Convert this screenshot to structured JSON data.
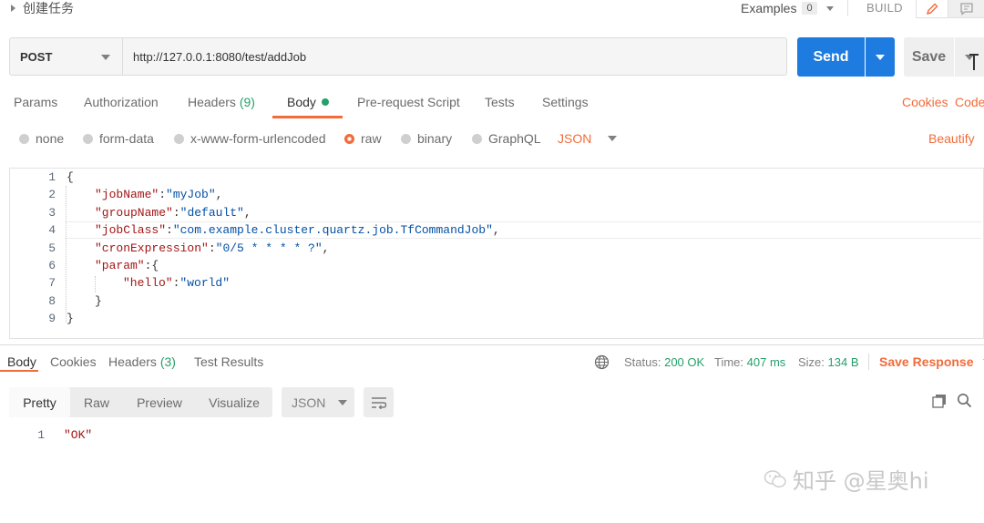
{
  "header": {
    "request_name": "创建任务",
    "examples_label": "Examples",
    "examples_count": "0",
    "build_label": "BUILD",
    "icons": [
      "pencil-icon",
      "comment-icon"
    ]
  },
  "request": {
    "method": "POST",
    "url": "http://127.0.0.1:8080/test/addJob",
    "send_label": "Send",
    "save_label": "Save"
  },
  "request_tabs": {
    "params": "Params",
    "authorization": "Authorization",
    "headers": "Headers",
    "headers_count": "(9)",
    "body": "Body",
    "prerequest": "Pre-request Script",
    "tests": "Tests",
    "settings": "Settings",
    "cookies": "Cookies",
    "code": "Code"
  },
  "body_types": {
    "none": "none",
    "form_data": "form-data",
    "urlencoded": "x-www-form-urlencoded",
    "raw": "raw",
    "binary": "binary",
    "graphql": "GraphQL",
    "format": "JSON",
    "beautify": "Beautify",
    "selected": "raw"
  },
  "editor": {
    "line_numbers": [
      "1",
      "2",
      "3",
      "4",
      "5",
      "6",
      "7",
      "8",
      "9"
    ],
    "body_json": {
      "jobName": "myJob",
      "groupName": "default",
      "jobClass": "com.example.cluster.quartz.job.TfCommandJob",
      "cronExpression": "0/5 * * * * ?",
      "param": {
        "hello": "world"
      }
    }
  },
  "response_tabs": {
    "body": "Body",
    "cookies": "Cookies",
    "headers": "Headers",
    "headers_count": "(3)",
    "test_results": "Test Results"
  },
  "response_meta": {
    "status_label": "Status:",
    "status_value": "200 OK",
    "time_label": "Time:",
    "time_value": "407 ms",
    "size_label": "Size:",
    "size_value": "134 B",
    "save_response": "Save Response"
  },
  "response_view": {
    "pretty": "Pretty",
    "raw": "Raw",
    "preview": "Preview",
    "visualize": "Visualize",
    "format": "JSON",
    "line_number": "1",
    "value": "\"OK\""
  },
  "watermark": {
    "text": "知乎 @星奥hi",
    "logo": "wechat-logo-icon"
  },
  "colors": {
    "accent_orange": "#f26b3a",
    "send_blue": "#1e7be0",
    "success_green": "#26a06a"
  }
}
